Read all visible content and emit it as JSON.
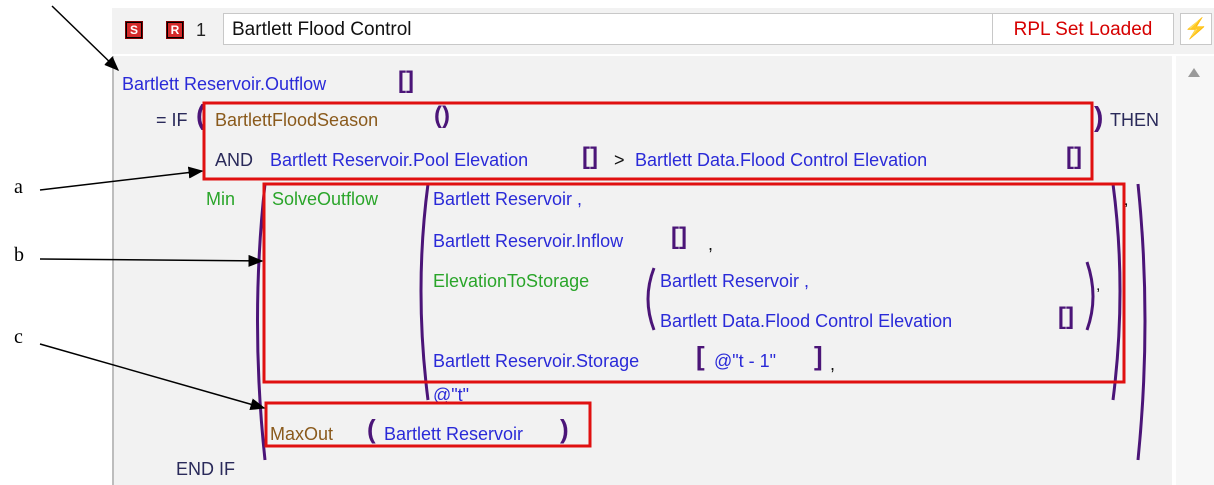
{
  "toolbar": {
    "s_icon": "S",
    "r_icon": "R",
    "rule_number": "1",
    "rule_name": "Bartlett Flood Control",
    "status": "RPL Set Loaded"
  },
  "code": {
    "line1": "Bartlett Reservoir.Outflow",
    "eq_if": "= IF",
    "cond1": "BartlettFloodSeason",
    "and_kw": "AND",
    "cond2a": "Bartlett Reservoir.Pool Elevation",
    "gt": ">",
    "cond2b": "Bartlett Data.Flood Control Elevation",
    "then_kw": "THEN",
    "min_kw": "Min",
    "solve_fn": "SolveOutflow",
    "arg1": "Bartlett Reservoir ,",
    "arg2": "Bartlett Reservoir.Inflow",
    "arg2_comma": ",",
    "elev_fn": "ElevationToStorage",
    "elev_arg1": "Bartlett Reservoir ,",
    "elev_arg2": "Bartlett Data.Flood Control Elevation",
    "arg4": "Bartlett Reservoir.Storage",
    "arg4_idx": "@\"t - 1\"",
    "arg4_comma": ",",
    "arg5": "@\"t\"",
    "maxout_fn": "MaxOut",
    "maxout_arg": "Bartlett Reservoir",
    "endif_kw": "END IF"
  },
  "callouts": {
    "a": "a",
    "b": "b",
    "c": "c"
  },
  "colors": {
    "object_ref": "#2a2ad8",
    "function": "#8a5a1c",
    "builtin": "#2aa52a",
    "bracket": "#4b1578",
    "highlight_box": "#e01010",
    "status": "#d60000"
  },
  "icons": {
    "toolbar_s": "s-icon",
    "toolbar_r": "r-icon",
    "toolbar_bolt": "lightning-bolt-icon",
    "scroll_up": "scroll-up-arrow-icon"
  }
}
